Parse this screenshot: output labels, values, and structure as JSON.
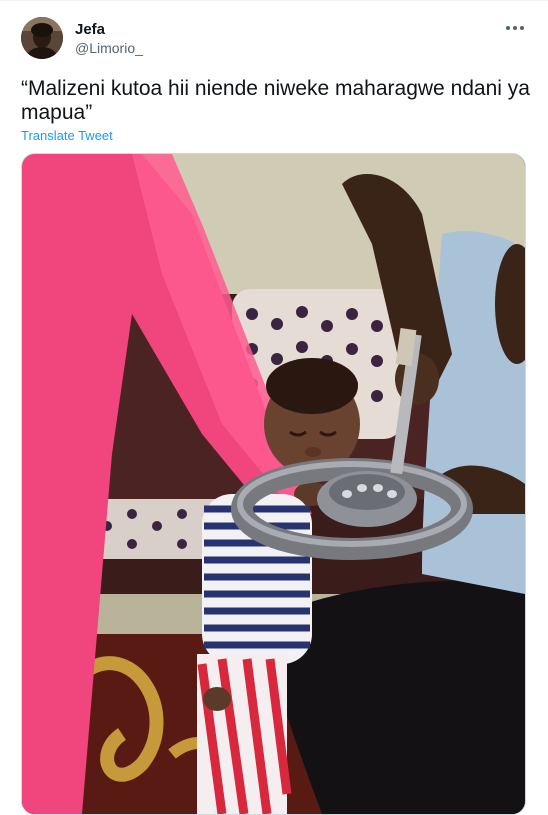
{
  "tweet": {
    "author_name": "Jefa",
    "author_handle": "@Limorio_",
    "more_icon": "more-horizontal-icon",
    "text": "“Malizeni kutoa hii niende niweke maharagwe ndani ya mapua”",
    "translate_label": "Translate Tweet"
  },
  "colors": {
    "link": "#1d9bf0",
    "secondary_text": "#536471",
    "primary_text": "#0f1419"
  }
}
